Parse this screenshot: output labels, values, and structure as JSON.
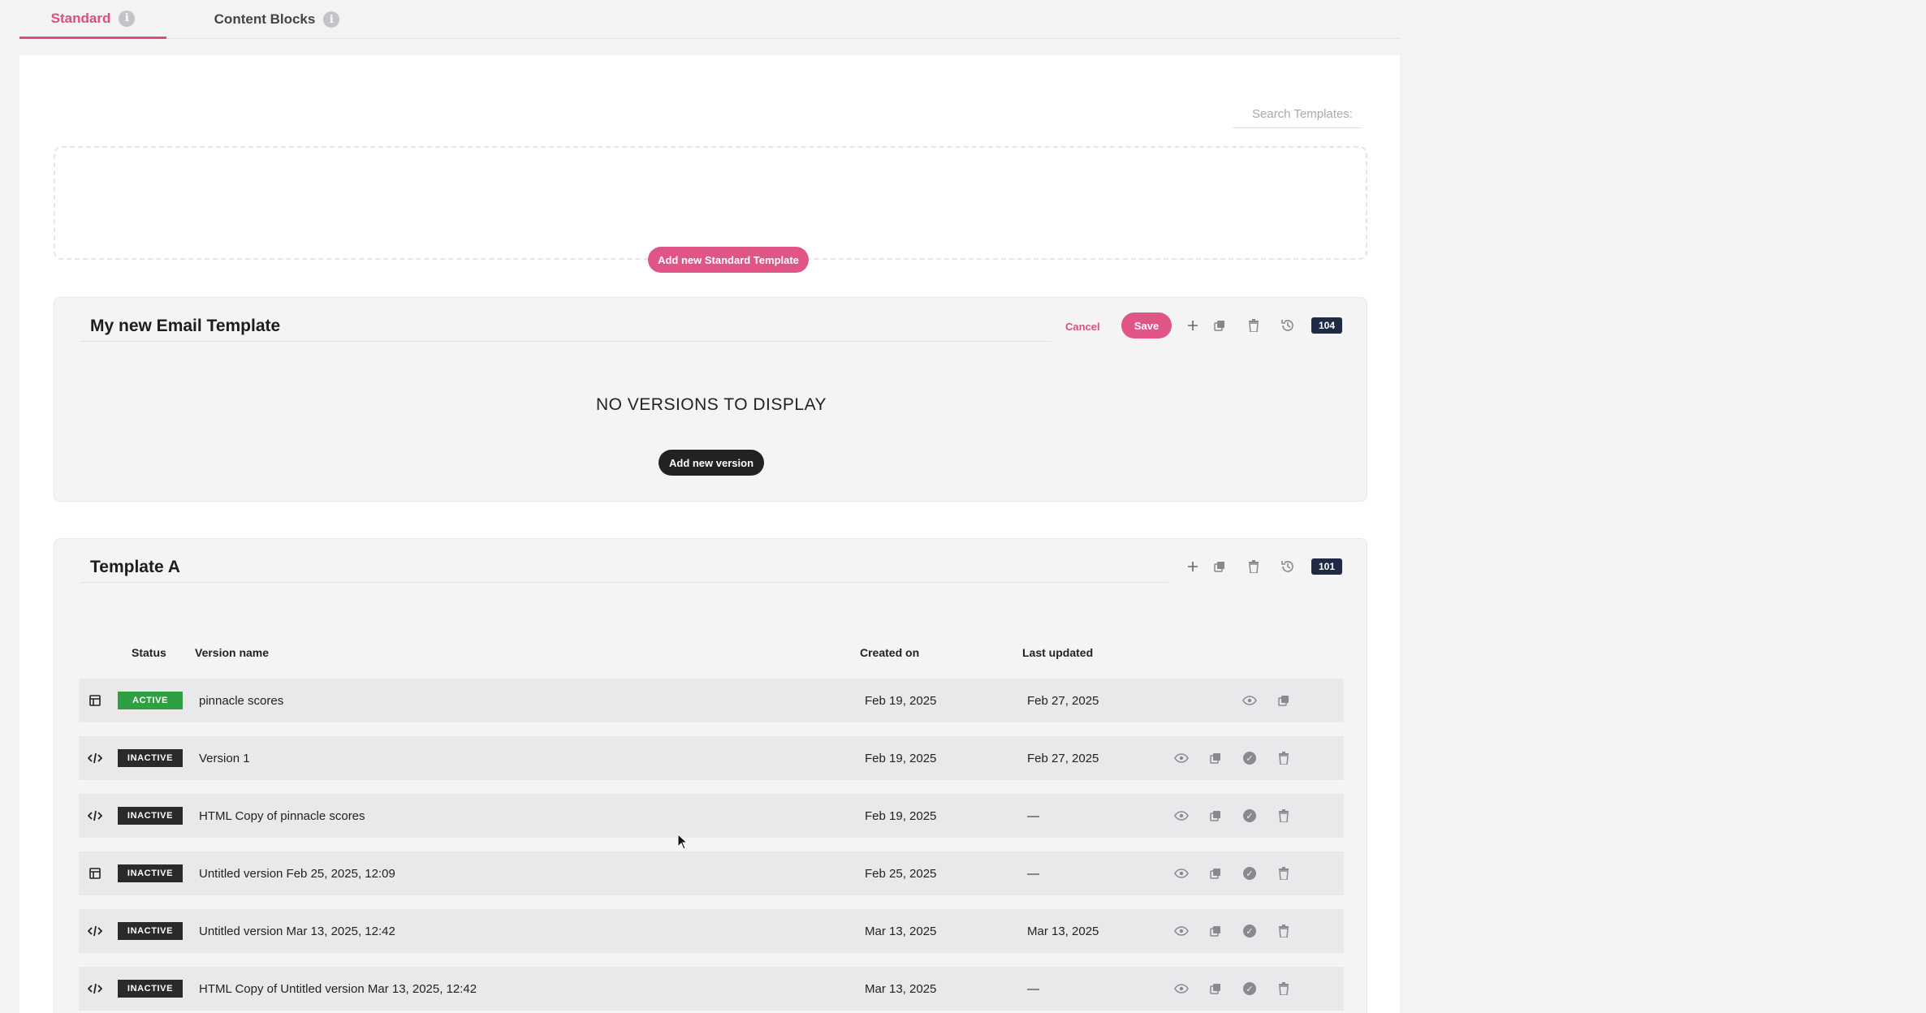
{
  "tabs": [
    {
      "label": "Standard",
      "active": true
    },
    {
      "label": "Content Blocks",
      "active": false
    }
  ],
  "search": {
    "placeholder": "Search Templates:"
  },
  "add_template_label": "Add new Standard Template",
  "editing_template": {
    "title": "My new Email Template",
    "cancel_label": "Cancel",
    "save_label": "Save",
    "id_badge": "104",
    "empty_message": "NO VERSIONS TO DISPLAY",
    "add_version_label": "Add new version"
  },
  "template_a": {
    "title": "Template A",
    "id_badge": "101",
    "columns": {
      "status": "Status",
      "version_name": "Version name",
      "created_on": "Created on",
      "last_updated": "Last updated"
    },
    "rows": [
      {
        "type": "layout-icon",
        "status": "ACTIVE",
        "name": "pinnacle scores",
        "created": "Feb 19, 2025",
        "updated": "Feb 27, 2025"
      },
      {
        "type": "code-icon",
        "status": "INACTIVE",
        "name": "Version 1",
        "created": "Feb 19, 2025",
        "updated": "Feb 27, 2025"
      },
      {
        "type": "code-icon",
        "status": "INACTIVE",
        "name": "HTML Copy of pinnacle scores",
        "created": "Feb 19, 2025",
        "updated": "—"
      },
      {
        "type": "layout-icon",
        "status": "INACTIVE",
        "name": "Untitled version Feb 25, 2025, 12:09",
        "created": "Feb 25, 2025",
        "updated": "—"
      },
      {
        "type": "code-icon",
        "status": "INACTIVE",
        "name": "Untitled version Mar 13, 2025, 12:42",
        "created": "Mar 13, 2025",
        "updated": "Mar 13, 2025"
      },
      {
        "type": "code-icon",
        "status": "INACTIVE",
        "name": "HTML Copy of Untitled version Mar 13, 2025, 12:42",
        "created": "Mar 13, 2025",
        "updated": "—"
      }
    ]
  },
  "colors": {
    "accent": "#e05585",
    "active": "#2ea043",
    "inactive": "#2a2a2c",
    "badge": "#1f2a44"
  }
}
